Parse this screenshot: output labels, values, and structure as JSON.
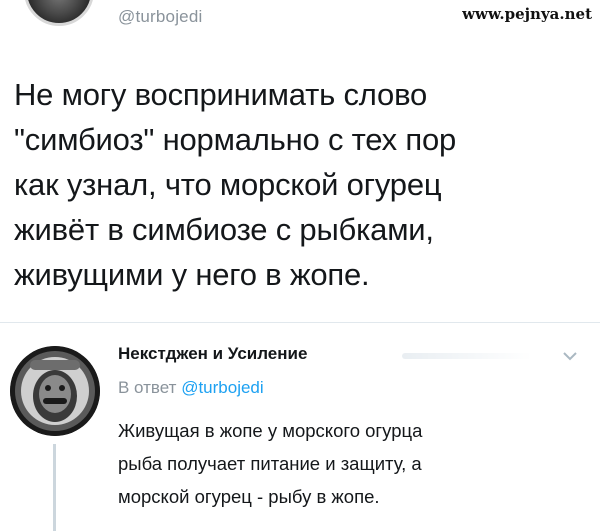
{
  "watermark": "www.pejnya.net",
  "original_tweet": {
    "handle": "@turbojedi",
    "text": "Не могу воспринимать слово\n\"симбиоз\" нормально с тех пор\nкак узнал, что морской огурец\nживёт в симбиозе с рыбками,\nживущими у него в жопе."
  },
  "reply": {
    "author_name": "Некстджен и Усиление",
    "reply_prefix": "В ответ",
    "reply_mention": "@turbojedi",
    "text": "Живущая в жопе у морского огурца\nрыба получает питание и защиту, а\nморской огурец - рыбу в жопе."
  },
  "icons": {
    "menu": "chevron-down-icon"
  },
  "colors": {
    "text": "#14171a",
    "muted": "#8a939b",
    "link": "#1da1f2",
    "divider": "#e1e8ed"
  }
}
